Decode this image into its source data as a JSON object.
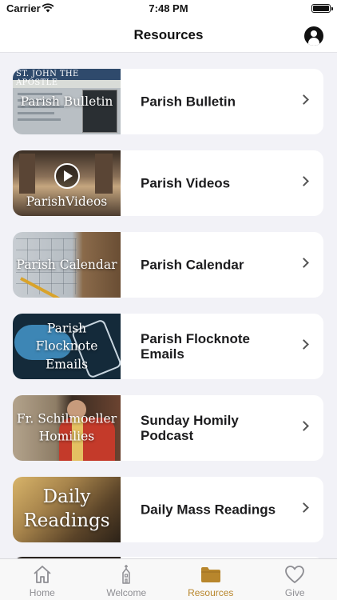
{
  "status_bar": {
    "carrier": "Carrier",
    "time": "7:48 PM"
  },
  "nav": {
    "title": "Resources"
  },
  "resources": [
    {
      "thumb_text": "Parish Bulletin",
      "label": "Parish Bulletin",
      "overlay_text": "ST. JOHN THE APOSTLE",
      "tint": "#8a9bb0"
    },
    {
      "thumb_text": "ParishVideos",
      "label": "Parish Videos",
      "tint": "#6b5744"
    },
    {
      "thumb_text": "Parish Calendar",
      "label": "Parish Calendar",
      "tint": "#9ea6ad"
    },
    {
      "thumb_text": "Parish Flocknote Emails",
      "label": "Parish Flocknote Emails",
      "tint": "#1c3548"
    },
    {
      "thumb_text": "Fr. Schilmoeller Homilies",
      "label": "Sunday Homily Podcast",
      "tint": "#8c5a3c"
    },
    {
      "thumb_text": "Daily Readings",
      "label": "Daily Mass Readings",
      "tint": "#6e5736"
    }
  ],
  "tabs": [
    {
      "label": "Home",
      "icon": "home-icon"
    },
    {
      "label": "Welcome",
      "icon": "church-icon"
    },
    {
      "label": "Resources",
      "icon": "folder-icon",
      "active": true
    },
    {
      "label": "Give",
      "icon": "heart-icon"
    }
  ],
  "colors": {
    "accent": "#b8862c",
    "background": "#f2f2f7",
    "card": "#ffffff"
  }
}
